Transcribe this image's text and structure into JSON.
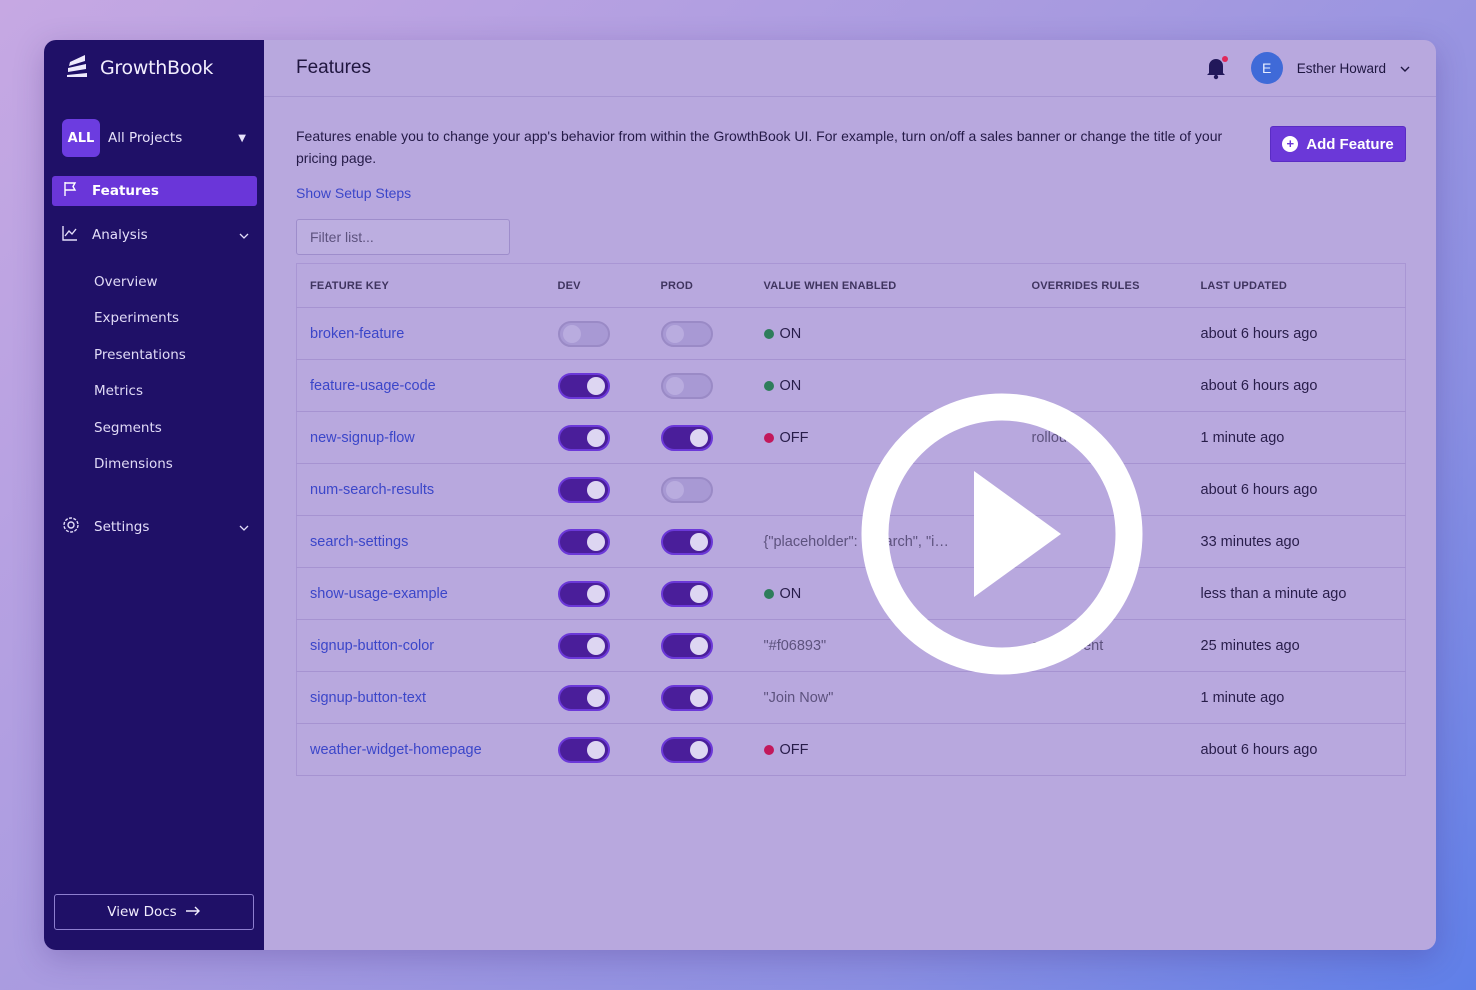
{
  "brand": {
    "name": "GrowthBook"
  },
  "project": {
    "badge": "ALL",
    "name": "All Projects"
  },
  "nav": {
    "features": "Features",
    "analysis": "Analysis",
    "analysis_items": [
      "Overview",
      "Experiments",
      "Presentations",
      "Metrics",
      "Segments",
      "Dimensions"
    ],
    "settings": "Settings"
  },
  "docs_button": "View Docs",
  "header": {
    "title": "Features",
    "user_initial": "E",
    "user_name": "Esther Howard"
  },
  "intro": "Features enable you to change your app's behavior from within the GrowthBook UI. For example, turn on/off a sales banner or change the title of your pricing page.",
  "add_feature": "Add Feature",
  "setup_link": "Show Setup Steps",
  "filter": {
    "placeholder": "Filter list..."
  },
  "colors": {
    "accent": "#6b38d8",
    "sidebar": "#1f1067",
    "on_dot": "#2e7d5b",
    "off_dot": "#c2185b"
  },
  "table": {
    "headers": [
      "FEATURE KEY",
      "DEV",
      "PROD",
      "VALUE WHEN ENABLED",
      "OVERRIDES RULES",
      "LAST UPDATED"
    ],
    "rows": [
      {
        "key": "broken-feature",
        "dev": false,
        "prod": false,
        "value": "ON",
        "value_type": "on",
        "overrides": "",
        "updated": "about 6 hours ago"
      },
      {
        "key": "feature-usage-code",
        "dev": true,
        "prod": false,
        "value": "ON",
        "value_type": "on",
        "overrides": "",
        "updated": "about 6 hours ago"
      },
      {
        "key": "new-signup-flow",
        "dev": true,
        "prod": true,
        "value": "OFF",
        "value_type": "off",
        "overrides": "rollout",
        "updated": "1 minute ago"
      },
      {
        "key": "num-search-results",
        "dev": true,
        "prod": false,
        "value": "",
        "value_type": "plain",
        "overrides": "",
        "updated": "about 6 hours ago"
      },
      {
        "key": "search-settings",
        "dev": true,
        "prod": true,
        "value": "{\"placeholder\": \"Search\", \"i…",
        "value_type": "str",
        "overrides": "",
        "updated": "33 minutes ago"
      },
      {
        "key": "show-usage-example",
        "dev": true,
        "prod": true,
        "value": "ON",
        "value_type": "on",
        "overrides": "",
        "updated": "less than a minute ago"
      },
      {
        "key": "signup-button-color",
        "dev": true,
        "prod": true,
        "value": "\"#f06893\"",
        "value_type": "str",
        "overrides": "experiment",
        "updated": "25 minutes ago"
      },
      {
        "key": "signup-button-text",
        "dev": true,
        "prod": true,
        "value": "\"Join Now\"",
        "value_type": "str",
        "overrides": "",
        "updated": "1 minute ago"
      },
      {
        "key": "weather-widget-homepage",
        "dev": true,
        "prod": true,
        "value": "OFF",
        "value_type": "off",
        "overrides": "",
        "updated": "about 6 hours ago"
      }
    ]
  }
}
